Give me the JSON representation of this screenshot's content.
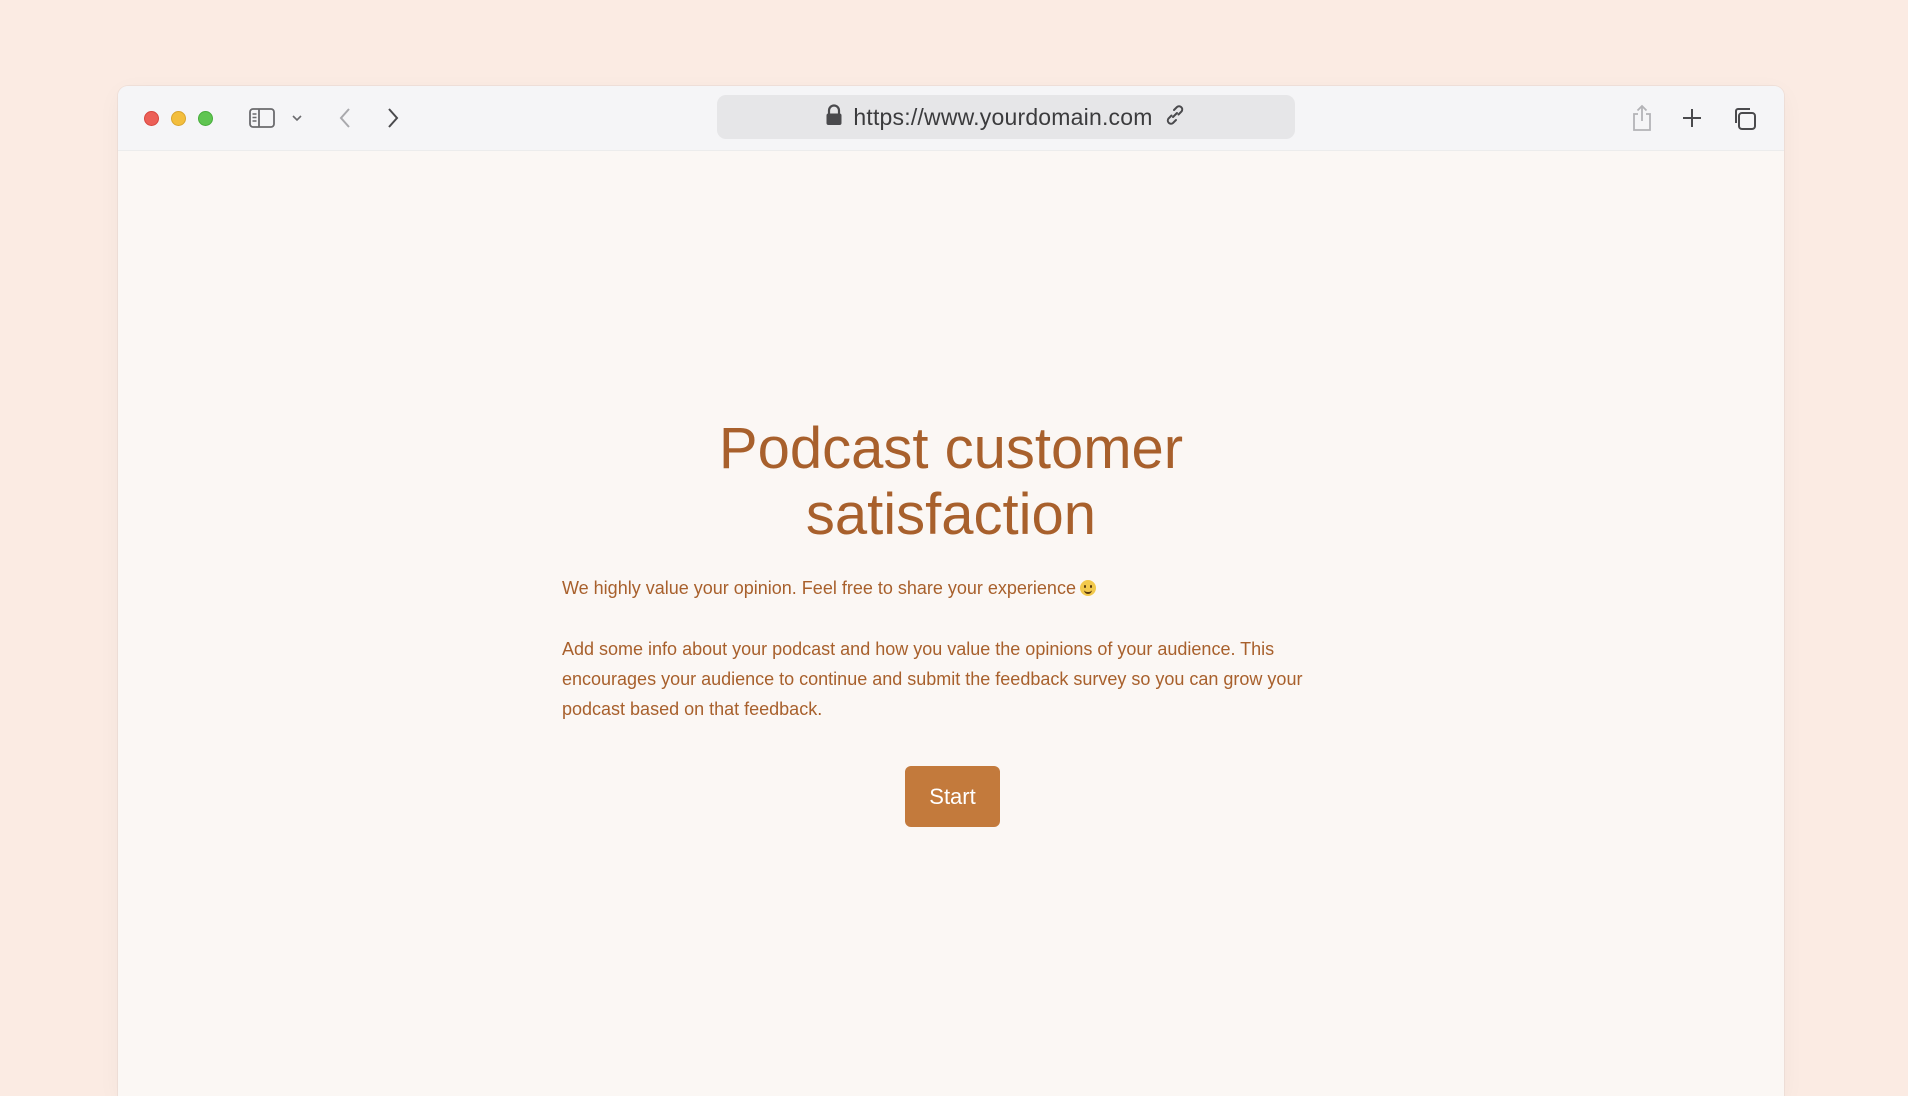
{
  "browser": {
    "url": "https://www.yourdomain.com",
    "icons": [
      "sidebar-icon",
      "chevron-down-icon",
      "back-icon",
      "forward-icon",
      "lock-icon",
      "link-icon",
      "share-icon",
      "plus-icon",
      "tabs-icon"
    ]
  },
  "page": {
    "title_line1": "Podcast customer",
    "title_line2": "satisfaction",
    "intro": "We highly value your opinion. Feel free to share your experience",
    "description": "Add some info about your podcast and how you value the opinions of your audience. This encourages your audience to continue and submit the feedback survey so you can grow your podcast based on that feedback.",
    "start_label": "Start"
  },
  "colors": {
    "background": "#fbebe3",
    "page": "#fbf7f4",
    "accent_text": "#a8602c",
    "button": "#c37a3c"
  }
}
